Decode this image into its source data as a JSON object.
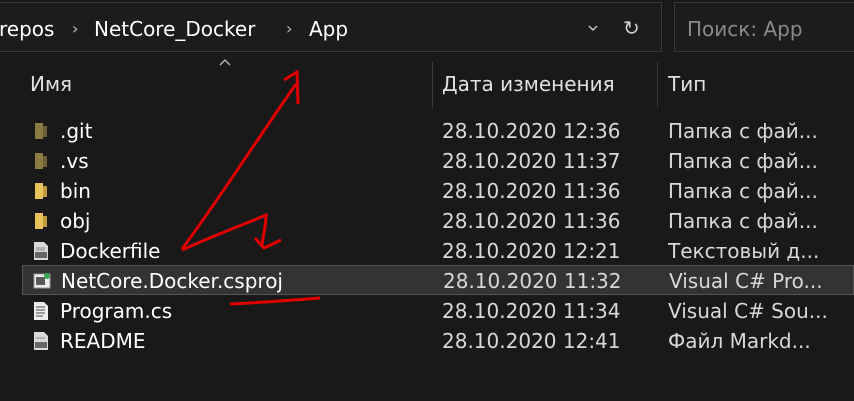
{
  "breadcrumb": [
    "repos",
    "NetCore_Docker",
    "App"
  ],
  "search": {
    "placeholder": "Поиск: App"
  },
  "columns": {
    "name": "Имя",
    "date": "Дата изменения",
    "type": "Тип"
  },
  "files": [
    {
      "name": ".git",
      "date": "28.10.2020 12:36",
      "type": "Папка с фай...",
      "icon": "folder-dim-icon"
    },
    {
      "name": ".vs",
      "date": "28.10.2020 11:37",
      "type": "Папка с фай...",
      "icon": "folder-dim-icon"
    },
    {
      "name": "bin",
      "date": "28.10.2020 11:36",
      "type": "Папка с фай...",
      "icon": "folder-icon"
    },
    {
      "name": "obj",
      "date": "28.10.2020 11:36",
      "type": "Папка с фай...",
      "icon": "folder-icon"
    },
    {
      "name": "Dockerfile",
      "date": "28.10.2020 12:21",
      "type": "Текстовый д...",
      "icon": "text-file-icon"
    },
    {
      "name": "NetCore.Docker.csproj",
      "date": "28.10.2020 11:32",
      "type": "Visual C# Pro...",
      "icon": "csproj-file-icon"
    },
    {
      "name": "Program.cs",
      "date": "28.10.2020 11:34",
      "type": "Visual C# Sou...",
      "icon": "cs-file-icon"
    },
    {
      "name": "README",
      "date": "28.10.2020 12:41",
      "type": "Файл Markd...",
      "icon": "markdown-file-icon"
    }
  ],
  "colors": {
    "background": "#191919",
    "annotation": "#e00000",
    "folder": "#e8c25a",
    "folder_dim": "#8c7a45"
  }
}
